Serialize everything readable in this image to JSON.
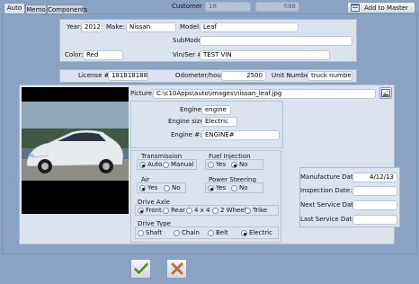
{
  "tabs": [
    {
      "label": "Auto",
      "active": true
    },
    {
      "label": "Memo",
      "active": false
    },
    {
      "label": "Components",
      "active": false
    }
  ],
  "header": {
    "customer_label": "Customer #:",
    "customer_id": "18",
    "customer_code": "688",
    "add_master_label": "Add to Master"
  },
  "vehicle": {
    "year_label": "Year:",
    "year": "2012",
    "make_label": "Make:",
    "make": "Nissan",
    "model_label": "Model:",
    "model": "Leaf",
    "submodel_label": "SubModel:",
    "submodel": "",
    "color_label": "Color:",
    "color": "Red",
    "vin_label": "Vin/Ser #:",
    "vin": "TEST VIN"
  },
  "license": {
    "license_label": "License #:",
    "license": "1818181881",
    "odometer_label": "Odometer/hours:",
    "odometer": "2500",
    "unit_label": "Unit Number:",
    "unit": "truck number"
  },
  "picture": {
    "label": "Picture:",
    "path": "C:\\c10Apps\\auto\\images\\nissan_leaf.jpg"
  },
  "engine": {
    "engine_label": "Engine:",
    "engine": "engine",
    "size_label": "Engine size:",
    "size": "Electric",
    "number_label": "Engine #:",
    "number": "ENGINE#"
  },
  "options": {
    "transmission": {
      "label": "Transmission",
      "options": [
        "Auto",
        "Manual"
      ],
      "selected": "Auto"
    },
    "fuel_injection": {
      "label": "Fuel Injection",
      "options": [
        "Yes",
        "No"
      ],
      "selected": "No"
    },
    "air": {
      "label": "Air",
      "options": [
        "Yes",
        "No"
      ],
      "selected": "Yes"
    },
    "power_steering": {
      "label": "Power Steering",
      "options": [
        "Yes",
        "No"
      ],
      "selected": "Yes"
    },
    "drive_axle": {
      "label": "Drive Axle",
      "options": [
        "Front",
        "Rear",
        "4 x 4",
        "2 Wheel",
        "Trike"
      ],
      "selected": "Front"
    },
    "drive_type": {
      "label": "Drive Type",
      "options": [
        "Shaft",
        "Chain",
        "Belt",
        "Electric"
      ],
      "selected": "Electric"
    }
  },
  "service": {
    "manufacture_label": "Manufacture Date:",
    "manufacture": "4/12/13",
    "inspection_label": "Inspection Date:",
    "inspection": "",
    "next_label": "Next Service Date:",
    "next": "",
    "last_label": "Last Service Date:",
    "last": ""
  },
  "icons": {
    "ok": "checkmark-icon",
    "cancel": "x-icon",
    "browse": "browse-image-icon",
    "add": "add-master-icon"
  }
}
